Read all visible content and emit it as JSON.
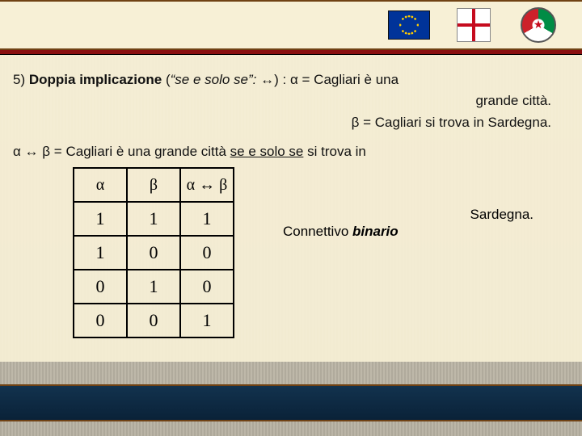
{
  "header": {
    "emblems": [
      "eu-flag",
      "sardinia-flag",
      "italy-emblem"
    ]
  },
  "heading": {
    "number": "5)",
    "title": "Doppia implicazione",
    "paren_open": "(",
    "italic": "“se e solo se”:",
    "symbol": "↔",
    "paren_close": ") :",
    "alpha_def": "α = Cagliari è una",
    "alpha_def_tail": "grande città.",
    "beta_def": "β = Cagliari si trova in Sardegna."
  },
  "composed": {
    "lhs": "α ↔ β",
    "eq": "=",
    "text1": "Cagliari è una grande città ",
    "underlined": "se e solo se",
    "text2": " si trova in",
    "tail": "Sardegna."
  },
  "chart_data": {
    "type": "table",
    "title": "Truth table for biconditional (α ↔ β)",
    "columns": [
      "α",
      "β",
      "α ↔ β"
    ],
    "rows": [
      [
        1,
        1,
        1
      ],
      [
        1,
        0,
        0
      ],
      [
        0,
        1,
        0
      ],
      [
        0,
        0,
        1
      ]
    ]
  },
  "side_note": {
    "prefix": "Connettivo ",
    "bold": "binario"
  }
}
